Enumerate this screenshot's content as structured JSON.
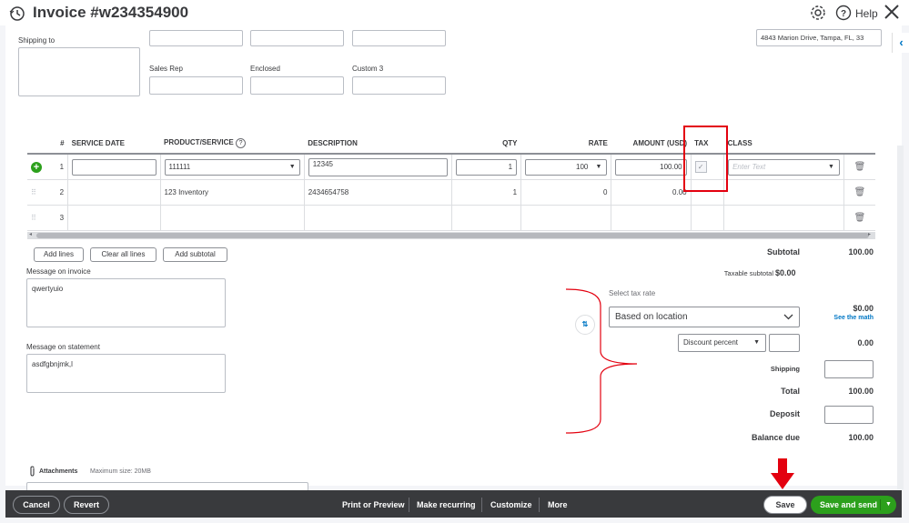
{
  "header": {
    "title": "Invoice #w234354900",
    "help_label": "Help"
  },
  "form": {
    "shipping_to_label": "Shipping to",
    "sales_rep_label": "Sales Rep",
    "enclosed_label": "Enclosed",
    "custom3_label": "Custom 3",
    "address_value": "4843  Marion Drive, Tampa, FL, 33"
  },
  "table": {
    "headers": {
      "num": "#",
      "service_date": "SERVICE DATE",
      "product": "PRODUCT/SERVICE",
      "description": "DESCRIPTION",
      "qty": "QTY",
      "rate": "RATE",
      "amount": "AMOUNT (USD)",
      "tax": "TAX",
      "class": "CLASS"
    },
    "rows": [
      {
        "num": "1",
        "product": "111111",
        "description": "12345",
        "qty": "1",
        "rate": "100",
        "amount": "100.00",
        "class_placeholder": "Enter Text"
      },
      {
        "num": "2",
        "product": "123 Inventory",
        "description": "2434654758",
        "qty": "1",
        "rate": "0",
        "amount": "0.00"
      },
      {
        "num": "3",
        "product": "",
        "description": "",
        "qty": "",
        "rate": "",
        "amount": ""
      }
    ]
  },
  "actions": {
    "add_lines": "Add lines",
    "clear_all_lines": "Clear all lines",
    "add_subtotal": "Add subtotal"
  },
  "messages": {
    "invoice_label": "Message on invoice",
    "invoice_value": "qwertyuio",
    "statement_label": "Message on statement",
    "statement_value": "asdfgbnjmk,l"
  },
  "totals": {
    "subtotal_label": "Subtotal",
    "subtotal_value": "100.00",
    "taxable_subtotal_label": "Taxable subtotal",
    "taxable_subtotal_value": "$0.00",
    "select_tax_rate_label": "Select tax rate",
    "tax_rate_value": "Based on location",
    "tax_amount": "$0.00",
    "see_the_math": "See the math",
    "discount_type": "Discount percent",
    "discount_amount": "0.00",
    "shipping_label": "Shipping",
    "total_label": "Total",
    "total_value": "100.00",
    "deposit_label": "Deposit",
    "balance_due_label": "Balance due",
    "balance_due_value": "100.00"
  },
  "attachments": {
    "label": "Attachments",
    "max_size": "Maximum size: 20MB"
  },
  "footer": {
    "cancel": "Cancel",
    "revert": "Revert",
    "print_preview": "Print or Preview",
    "make_recurring": "Make recurring",
    "customize": "Customize",
    "more": "More",
    "save": "Save",
    "save_and_send": "Save and send"
  },
  "colors": {
    "primary_green": "#2ca01c",
    "annotation_red": "#e3000f",
    "link_blue": "#0077c5",
    "footer_dark": "#393a3d"
  }
}
